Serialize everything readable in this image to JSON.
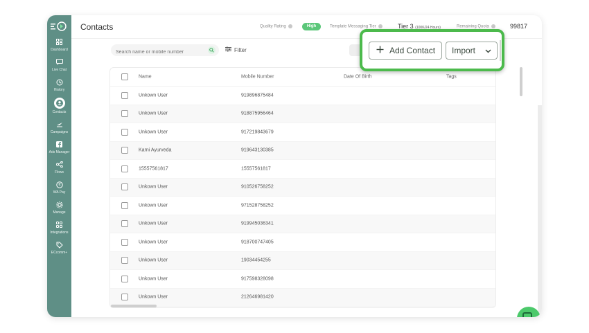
{
  "sidebar": {
    "items": [
      {
        "label": "Dashboard",
        "icon": "dashboard-icon"
      },
      {
        "label": "Live Chat",
        "icon": "chat-icon"
      },
      {
        "label": "History",
        "icon": "history-icon"
      },
      {
        "label": "Contacts",
        "icon": "contacts-icon",
        "active": true
      },
      {
        "label": "Campaigns",
        "icon": "campaigns-icon"
      },
      {
        "label": "Ads Manager",
        "icon": "facebook-icon"
      },
      {
        "label": "Flows",
        "icon": "flows-icon"
      },
      {
        "label": "WA Pay",
        "icon": "wa-pay-icon"
      },
      {
        "label": "Manage",
        "icon": "gear-icon"
      },
      {
        "label": "Integrations",
        "icon": "integrations-icon"
      },
      {
        "label": "ECcomm+",
        "icon": "tag-icon"
      }
    ]
  },
  "header": {
    "title": "Contacts",
    "quality_rating_label": "Quality Rating",
    "quality_value": "High",
    "template_tier_label": "Template Messaging Tier",
    "tier_value": "Tier 3",
    "tier_note": "(100K/24 Hours)",
    "remaining_quota_label": "Remaining Quota",
    "quota_value": "99817"
  },
  "toolbar": {
    "search_placeholder": "Search name or mobile number",
    "filter_label": "Filter",
    "add_contact_label": "Add Contact",
    "import_label": "Import"
  },
  "table": {
    "columns": [
      "Name",
      "Mobile Number",
      "Date Of Birth",
      "Tags"
    ],
    "rows": [
      {
        "name": "Unkown User",
        "mobile": "919896875484"
      },
      {
        "name": "Unkown User",
        "mobile": "918875956464"
      },
      {
        "name": "Unkown User",
        "mobile": "917219843679"
      },
      {
        "name": "Karni Ayurveda",
        "mobile": "919643130385"
      },
      {
        "name": "15557561817",
        "mobile": "15557561817"
      },
      {
        "name": "Unkown User",
        "mobile": "910526758252"
      },
      {
        "name": "Unkown User",
        "mobile": "971528758252"
      },
      {
        "name": "Unkown User",
        "mobile": "919945036341"
      },
      {
        "name": "Unkown User",
        "mobile": "918700747405"
      },
      {
        "name": "Unkown User",
        "mobile": "19034454255"
      },
      {
        "name": "Unkown User",
        "mobile": "917598328098"
      },
      {
        "name": "Unkown User",
        "mobile": "212646981420"
      }
    ]
  },
  "colors": {
    "sidebar": "#5f8f86",
    "accent": "#4cba4c",
    "badge": "#5cc77a"
  }
}
